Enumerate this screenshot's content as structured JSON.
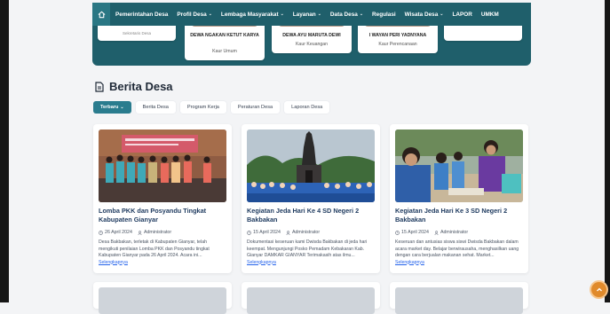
{
  "nav": {
    "items": [
      {
        "label": "Pemerintahan Desa",
        "has_dropdown": false
      },
      {
        "label": "Profil Desa",
        "has_dropdown": true
      },
      {
        "label": "Lembaga Masyarakat",
        "has_dropdown": true
      },
      {
        "label": "Layanan",
        "has_dropdown": true
      },
      {
        "label": "Data Desa",
        "has_dropdown": true
      },
      {
        "label": "Regulasi",
        "has_dropdown": false
      },
      {
        "label": "Wisata Desa",
        "has_dropdown": true
      },
      {
        "label": "LAPOR",
        "has_dropdown": false
      },
      {
        "label": "UMKM",
        "has_dropdown": false
      }
    ]
  },
  "officials": [
    {
      "name": "",
      "role": "",
      "small": "Sekretaris Desa"
    },
    {
      "name": "DEWA NGAKAN KETUT KARYA",
      "role": "Kaur Umum"
    },
    {
      "name": "DEWA AYU MARUTA DEWI",
      "role": "Kaur Keuangan"
    },
    {
      "name": "I WAYAN PERI YADNYANA",
      "role": "Kaur Perencanaan"
    }
  ],
  "section": {
    "title": "Berita Desa"
  },
  "tabs": [
    {
      "label": "Terbaru",
      "active": true
    },
    {
      "label": "Berita Desa",
      "active": false
    },
    {
      "label": "Program Kerja",
      "active": false
    },
    {
      "label": "Peraturan Desa",
      "active": false
    },
    {
      "label": "Laporan Desa",
      "active": false
    }
  ],
  "news": [
    {
      "title": "Lomba PKK dan Posyandu Tingkat Kabupaten Gianyar",
      "date": "26 April 2024",
      "author": "Administrator",
      "excerpt": "Desa Bakbakan, terletak di Kabupaten Gianyar, telah mengikuti penilaian Lomba PKK dan Posyandu tingkat Kabupaten Gianyar pada 26 April 2024. Acara ini...",
      "read_more": "Selengkapnya"
    },
    {
      "title": "Kegiatan Jeda Hari Ke 4 SD Negeri 2 Bakbakan",
      "date": "15 April 2024",
      "author": "Administrator",
      "excerpt": "Dokumentasi keseruan kami Dwisda Bakbakan di jeda hari keempat. Mengunjungi Posko Pemadam Kebakaran Kab. Gianyar DAMKAR GIANYAR Terimakasih atas ilmu...",
      "read_more": "Selengkapnya"
    },
    {
      "title": "Kegiatan Jeda Hari Ke 3 SD Negeri 2 Bakbakan",
      "date": "15 April 2024",
      "author": "Administrator",
      "excerpt": "Keseruan dan antusias siswa siswi Dwisda Bakbakan dalam acara market day. Belajar berwirausaha, menghasilkan uang dengan cara berjualan makanan sehat. Market...",
      "read_more": "Selengkapnya"
    }
  ],
  "colors": {
    "primary": "#1f5f6b",
    "tab_active": "#2a7c8e",
    "link": "#2563eb",
    "scroll_button": "#e08a2c"
  }
}
